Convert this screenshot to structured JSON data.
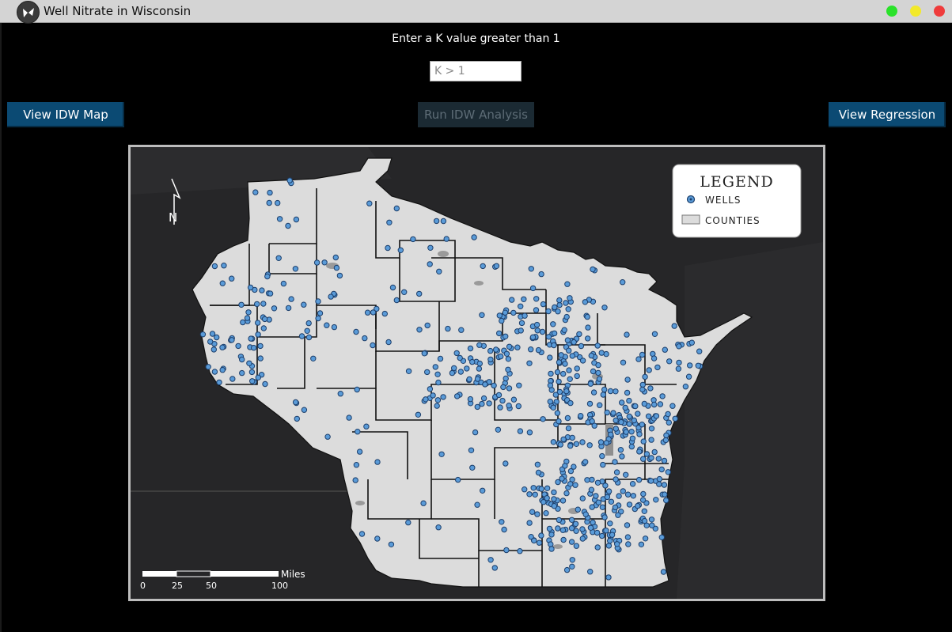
{
  "window": {
    "title": "Well Nitrate in Wisconsin",
    "icon": "butterfly-icon"
  },
  "controls": {
    "prompt": "Enter a K value greater than 1",
    "k_placeholder": "K > 1",
    "k_value": "",
    "view_idw_label": "View IDW Map",
    "run_idw_label": "Run IDW Analysis",
    "view_regression_label": "View Regression"
  },
  "map": {
    "north_label": "N",
    "legend": {
      "title": "LEGEND",
      "items": [
        {
          "label": "WELLS",
          "symbol": "well-point-icon"
        },
        {
          "label": "COUNTIES",
          "symbol": "county-polygon-icon"
        }
      ]
    },
    "scale_bar": {
      "unit": "Miles",
      "ticks": [
        "0",
        "25",
        "50",
        "100"
      ]
    },
    "colors": {
      "land": "#dcdcdc",
      "water": "#262628",
      "county_border": "#111111",
      "well_fill": "#5a9bd8"
    }
  }
}
